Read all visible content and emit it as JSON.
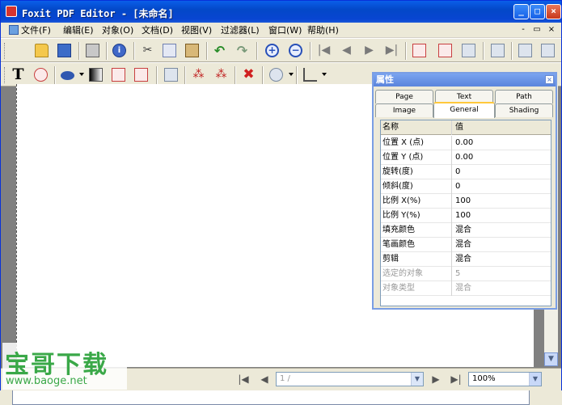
{
  "window": {
    "title": "Foxit PDF Editor - [未命名]",
    "minimize": "_",
    "restore": "□",
    "close": "×"
  },
  "menus": [
    "文件(F)",
    "编辑(E)",
    "对象(O)",
    "文档(D)",
    "视图(V)",
    "过滤器(L)",
    "窗口(W)",
    "帮助(H)"
  ],
  "mdi_controls": {
    "min": "-",
    "restore": "▭",
    "close": "×"
  },
  "toolbar1": [
    "new-page-icon",
    "open-folder-icon",
    "save-disk-icon",
    "printer-icon",
    "info-icon",
    "cut-icon",
    "copy-icon",
    "paste-icon",
    "undo-icon",
    "redo-icon",
    "zoom-in-icon",
    "zoom-out-icon",
    "first-page-icon",
    "prev-page-icon",
    "next-page-icon",
    "last-page-icon",
    "page-props-icon",
    "insert-page-icon",
    "delete-page-icon",
    "keyboard-icon",
    "text-edit-icon",
    "columns-icon"
  ],
  "toolbar1_symbols": {
    "scissors": "✂",
    "undo": "↶",
    "redo": "↷",
    "zoomin": "+",
    "zoomout": "−",
    "first": "|◀",
    "prev": "◀",
    "next": "▶",
    "last": "▶|",
    "info": "i"
  },
  "toolbar2_symbols": {
    "text": "T",
    "x": "✖",
    "dots": "⁂"
  },
  "document": {
    "watermark_title": "宝哥下载",
    "watermark_url": "www.baoge.net"
  },
  "status": {
    "first": "|◀",
    "prev": "◀",
    "page": "1 / ",
    "next": "▶",
    "last": "▶|",
    "zoom": "100%",
    "arrow": "▼"
  },
  "properties": {
    "title": "属性",
    "close": "×",
    "tabs_row1": [
      "Page",
      "Text",
      "Path"
    ],
    "tabs_row2": [
      "Image",
      "General",
      "Shading"
    ],
    "active_tab": "General",
    "header": {
      "name": "名称",
      "value": "值"
    },
    "rows": [
      {
        "name": "位置 X (点)",
        "value": "0.00",
        "enabled": true
      },
      {
        "name": "位置 Y (点)",
        "value": "0.00",
        "enabled": true
      },
      {
        "name": "旋转(度)",
        "value": "0",
        "enabled": true
      },
      {
        "name": "倾斜(度)",
        "value": "0",
        "enabled": true
      },
      {
        "name": "比例 X(%)",
        "value": "100",
        "enabled": true
      },
      {
        "name": "比例 Y(%)",
        "value": "100",
        "enabled": true
      },
      {
        "name": "填充颜色",
        "value": "混合",
        "enabled": true
      },
      {
        "name": "笔画颜色",
        "value": "混合",
        "enabled": true
      },
      {
        "name": "剪辑",
        "value": "混合",
        "enabled": true
      },
      {
        "name": "选定的对象",
        "value": "5",
        "enabled": false
      },
      {
        "name": "对象类型",
        "value": "混合",
        "enabled": false
      }
    ]
  }
}
